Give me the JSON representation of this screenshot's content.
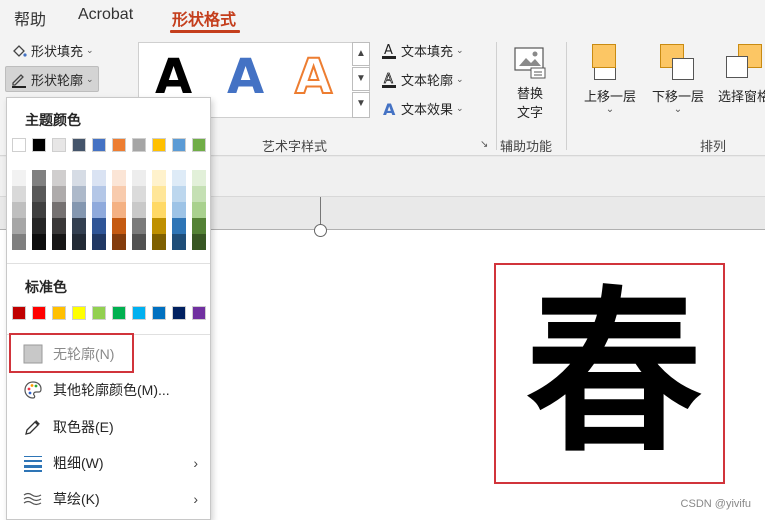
{
  "tabs": [
    {
      "label": "帮助",
      "active": false
    },
    {
      "label": "Acrobat",
      "active": false
    },
    {
      "label": "形状格式",
      "active": true
    }
  ],
  "shape_styles": {
    "fill_label": "形状填充",
    "outline_label": "形状轮廓"
  },
  "wordart": {
    "sample_letter": "A",
    "text_fill_label": "文本填充",
    "text_outline_label": "文本轮廓",
    "text_effects_label": "文本效果",
    "group_label": "艺术字样式"
  },
  "accessibility": {
    "alt_text_line1": "替换",
    "alt_text_line2": "文字",
    "group_label": "辅助功能"
  },
  "arrange": {
    "bring_forward": "上移一层",
    "send_backward": "下移一层",
    "selection_pane": "选择窗格",
    "group_label": "排列"
  },
  "menu": {
    "theme_colors_title": "主题颜色",
    "standard_colors_title": "标准色",
    "theme_top": [
      "#ffffff",
      "#000000",
      "#e7e6e6",
      "#44546a",
      "#4472c4",
      "#ed7d31",
      "#a5a5a5",
      "#ffc000",
      "#5b9bd5",
      "#70ad47"
    ],
    "theme_shades": [
      [
        "#f2f2f2",
        "#808080",
        "#d0cece",
        "#d6dce5",
        "#dae3f3",
        "#fbe5d6",
        "#ededed",
        "#fff2cc",
        "#deebf7",
        "#e2f0d9"
      ],
      [
        "#d9d9d9",
        "#595959",
        "#aeabab",
        "#adb9ca",
        "#b4c7e7",
        "#f8cbad",
        "#dbdbdb",
        "#ffe699",
        "#bdd7ee",
        "#c5e0b4"
      ],
      [
        "#bfbfbf",
        "#404040",
        "#757171",
        "#8497b0",
        "#8faadc",
        "#f4b183",
        "#c9c9c9",
        "#ffd966",
        "#9dc3e6",
        "#a9d18e"
      ],
      [
        "#a6a6a6",
        "#262626",
        "#3a3838",
        "#333f50",
        "#2f5597",
        "#c55a11",
        "#7b7b7b",
        "#bf9000",
        "#2e75b6",
        "#548235"
      ],
      [
        "#7f7f7f",
        "#0d0d0d",
        "#171616",
        "#222a35",
        "#203864",
        "#843c0c",
        "#525252",
        "#7f6000",
        "#1f4e79",
        "#385723"
      ]
    ],
    "standard": [
      "#c00000",
      "#ff0000",
      "#ffc000",
      "#ffff00",
      "#92d050",
      "#00b050",
      "#00b0f0",
      "#0070c0",
      "#002060",
      "#7030a0"
    ],
    "items": [
      {
        "label": "无轮廓(N)",
        "key": "N",
        "disabled": true
      },
      {
        "label": "其他轮廓颜色(M)...",
        "key": "M"
      },
      {
        "label": "取色器(E)",
        "key": "E"
      },
      {
        "label": "粗细(W)",
        "key": "W",
        "submenu": true
      },
      {
        "label": "草绘(K)",
        "key": "K",
        "submenu": true
      }
    ]
  },
  "slide": {
    "character": "春"
  },
  "watermark": "CSDN @yivifu",
  "colors": {
    "accent": "#c43e1c",
    "highlight_box": "#d1343b"
  }
}
